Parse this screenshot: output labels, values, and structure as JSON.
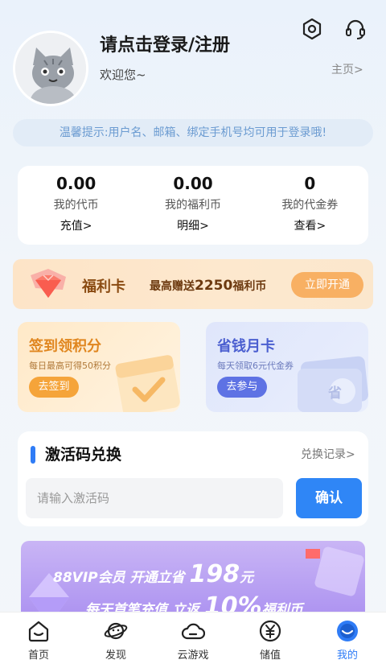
{
  "header": {
    "title": "请点击登录/注册",
    "welcome": "欢迎您~",
    "home_link": "主页>",
    "tip": "温馨提示:用户名、邮箱、绑定手机号均可用于登录哦!"
  },
  "wallet": [
    {
      "value": "0.00",
      "label": "我的代币",
      "action": "充值>"
    },
    {
      "value": "0.00",
      "label": "我的福利币",
      "action": "明细>"
    },
    {
      "value": "0",
      "label": "我的代金券",
      "action": "查看>"
    }
  ],
  "fuli_card": {
    "title": "福利卡",
    "sub_prefix": "最高赠送",
    "sub_amount": "2250",
    "sub_suffix": "福利币",
    "button": "立即开通"
  },
  "sign_card": {
    "title": "签到领积分",
    "sub": "每日最高可得50积分",
    "button": "去签到"
  },
  "month_card": {
    "title": "省钱月卡",
    "sub": "每天领取6元代金券",
    "button": "去参与",
    "coin_char": "省"
  },
  "redeem": {
    "title": "激活码兑换",
    "record": "兑换记录>",
    "placeholder": "请输入激活码",
    "button": "确认"
  },
  "banner": {
    "line1_a": "88VIP会员 开通立省",
    "line1_big": "198",
    "line1_b": "元",
    "line2_a": "每天首笔充值 立返",
    "line2_big": "10%",
    "line2_b": "福利币"
  },
  "nav": [
    {
      "label": "首页",
      "icon": "home-icon"
    },
    {
      "label": "发现",
      "icon": "planet-icon"
    },
    {
      "label": "云游戏",
      "icon": "cloud-icon"
    },
    {
      "label": "储值",
      "icon": "yen-icon"
    },
    {
      "label": "我的",
      "icon": "profile-icon",
      "active": true
    }
  ],
  "colors": {
    "accent": "#2f7cf6",
    "fuli_button": "#f8b063",
    "sign_button": "#f5a43a",
    "month_button": "#5e72e4"
  }
}
